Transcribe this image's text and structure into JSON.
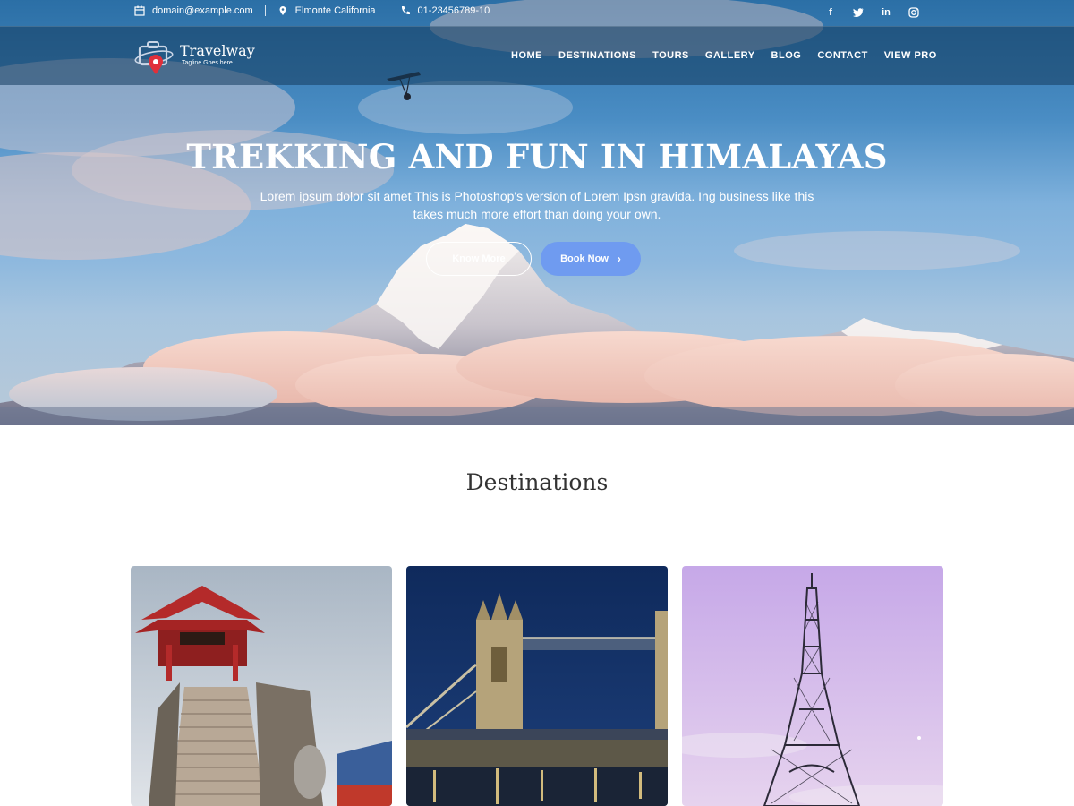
{
  "topbar": {
    "email": "domain@example.com",
    "location": "Elmonte California",
    "phone": "01-23456789-10",
    "email_icon": "calendar-icon",
    "location_icon": "map-pin-icon",
    "phone_icon": "phone-icon",
    "social": [
      {
        "name": "facebook-icon",
        "glyph": "f"
      },
      {
        "name": "twitter-icon",
        "glyph": "t"
      },
      {
        "name": "linkedin-icon",
        "glyph": "in"
      },
      {
        "name": "instagram-icon",
        "glyph": "◎"
      }
    ]
  },
  "header": {
    "logo_name": "Travelway",
    "logo_tagline": "Tagline Goes here",
    "nav": [
      "HOME",
      "DESTINATIONS",
      "TOURS",
      "GALLERY",
      "BLOG",
      "CONTACT",
      "VIEW PRO"
    ]
  },
  "hero": {
    "title": "TREKKING AND FUN IN HIMALAYAS",
    "subtitle": "Lorem ipsum dolor sit amet This is Photoshop's version of Lorem Ipsn gravida. Ing business like this takes much more effort than doing your own.",
    "know_more_label": "Know More",
    "book_now_label": "Book Now",
    "book_now_icon": "chevron-right-icon"
  },
  "destinations": {
    "title": "Destinations",
    "cards": [
      {
        "name": "pagoda-temple-image"
      },
      {
        "name": "tower-bridge-image"
      },
      {
        "name": "eiffel-tower-image"
      }
    ]
  },
  "colors": {
    "accent": "#6f9bf0",
    "header_overlay": "#143c5f",
    "logo_red": "#e0303a"
  }
}
